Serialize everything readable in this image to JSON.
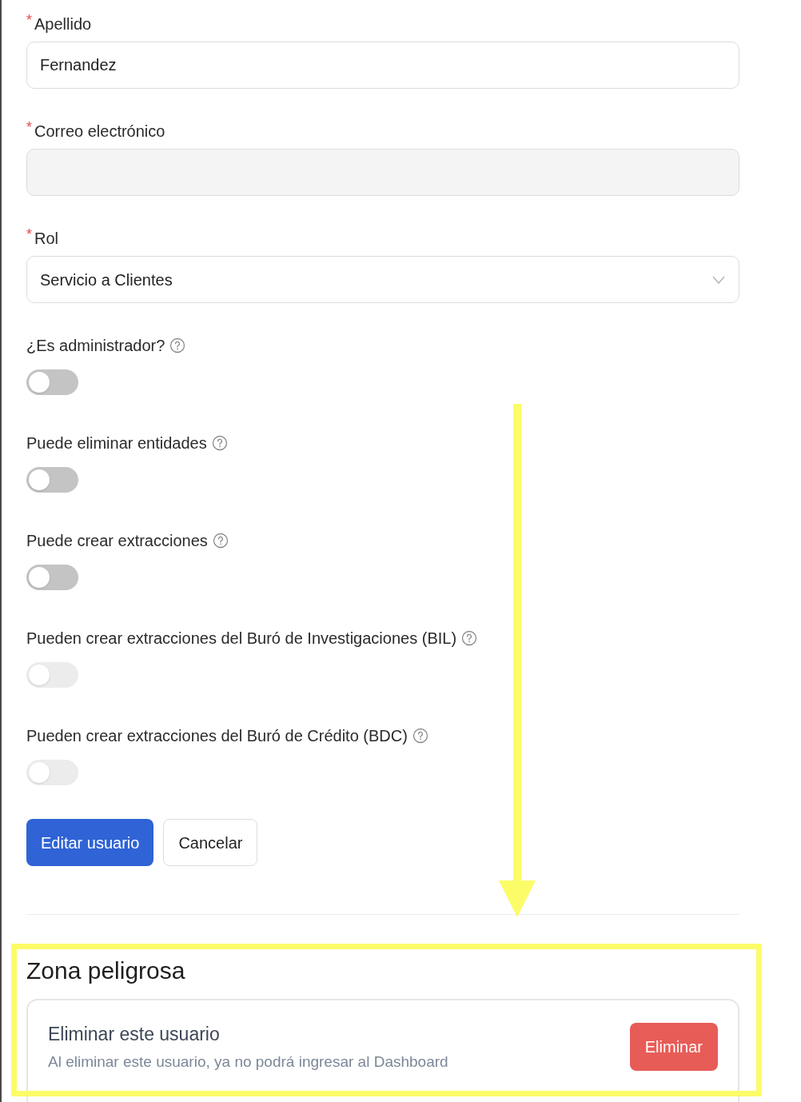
{
  "fields": [
    {
      "kind": "input",
      "required_mark": "*",
      "label": "Apellido",
      "value": "Fernandez"
    },
    {
      "kind": "locked",
      "required_mark": "*",
      "label": "Correo electrónico"
    },
    {
      "kind": "select",
      "required_mark": "*",
      "label": "Rol",
      "value": "Servicio a Clientes"
    }
  ],
  "toggles": [
    {
      "label": "¿Es administrador?",
      "on": false,
      "disabled": false
    },
    {
      "label": "Puede eliminar entidades",
      "on": false,
      "disabled": false
    },
    {
      "label": "Puede crear extracciones",
      "on": false,
      "disabled": false
    },
    {
      "label": "Pueden crear extracciones del Buró de Investigaciones (BIL)",
      "on": false,
      "disabled": true
    },
    {
      "label": "Pueden crear extracciones del Buró de Crédito (BDC)",
      "on": false,
      "disabled": true
    }
  ],
  "buttons": [
    {
      "kind": "primary",
      "label": "Editar usuario"
    },
    {
      "kind": "secondary",
      "label": "Cancelar"
    }
  ],
  "danger_zone": {
    "title": "Zona peligrosa",
    "card_title": "Eliminar este usuario",
    "card_description": "Al eliminar este usuario, ya no podrá ingresar al Dashboard",
    "button": "Eliminar"
  }
}
